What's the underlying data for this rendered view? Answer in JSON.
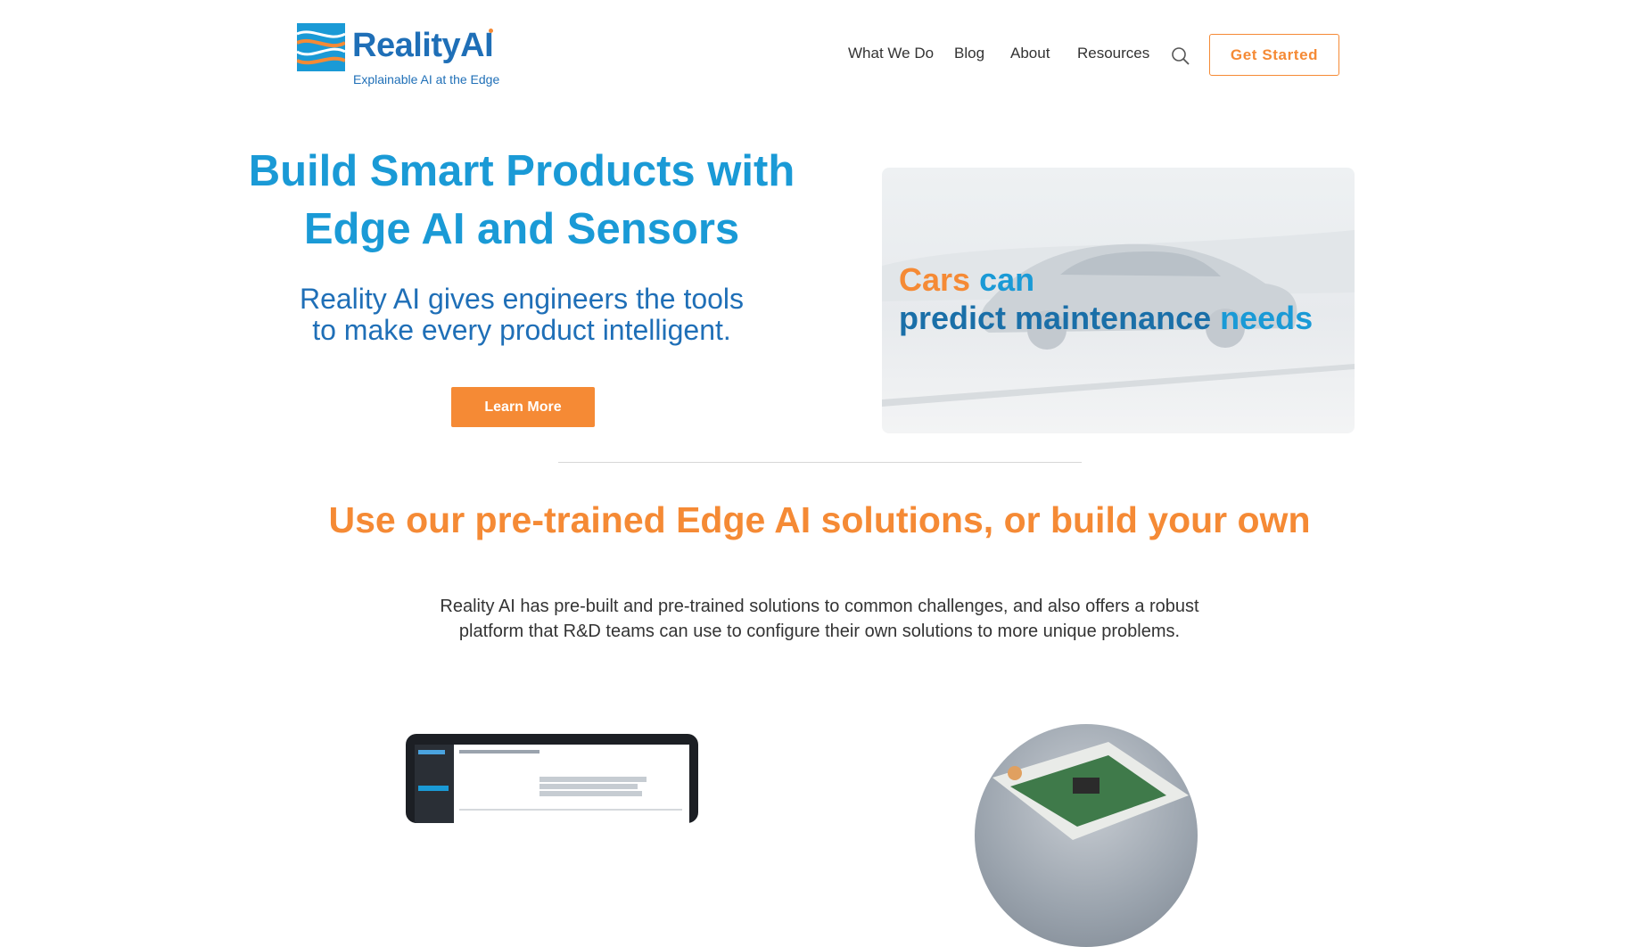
{
  "header": {
    "logo": {
      "name": "Reality",
      "name_ai": "AI",
      "tagline": "Explainable AI at the Edge"
    },
    "nav": [
      "What We Do",
      "Blog",
      "About",
      "Resources"
    ],
    "cta": "Get Started"
  },
  "hero": {
    "title_line1": "Build Smart Products with",
    "title_line2": "Edge AI and Sensors",
    "subtitle_line1": "Reality AI gives engineers the tools",
    "subtitle_line2": "to make every product intelligent.",
    "button": "Learn More",
    "card": {
      "word1": "Cars",
      "word2": "can",
      "word3": "predict",
      "word4": "maintenance",
      "word5": "needs"
    }
  },
  "section": {
    "title": "Use our pre-trained Edge AI solutions, or build your own",
    "desc_line1": "Reality AI has pre-built and pre-trained solutions to common challenges, and also offers a robust",
    "desc_line2": "platform that R&D teams can use to configure their own solutions to more unique problems."
  },
  "colors": {
    "orange": "#f58a35",
    "blue": "#1a9ad6",
    "dark_blue": "#1f6fb7"
  }
}
